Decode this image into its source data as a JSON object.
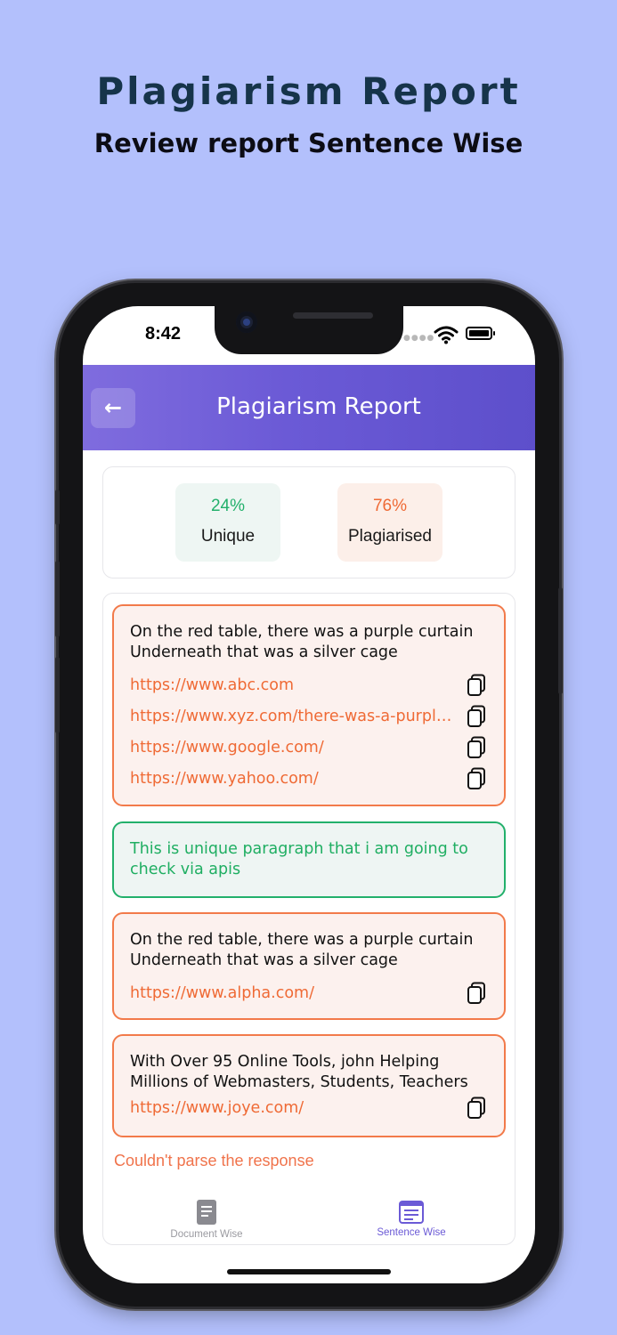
{
  "promo": {
    "title": "Plagiarism Report",
    "subtitle": "Review report Sentence Wise"
  },
  "status_bar": {
    "time": "8:42"
  },
  "header": {
    "title": "Plagiarism Report",
    "back_icon": "arrow-left-icon"
  },
  "stats": {
    "unique": {
      "percent": "24%",
      "label": "Unique",
      "color": "#22b06b"
    },
    "plagiarised": {
      "percent": "76%",
      "label": "Plagiarised",
      "color": "#ef6a35"
    }
  },
  "results": [
    {
      "type": "plagiarised",
      "text": "On the red table, there was a purple curtain Underneath that was a silver cage",
      "links": [
        "https://www.abc.com",
        "https://www.xyz.com/there-was-a-purple-curtain",
        "https://www.google.com/",
        "https://www.yahoo.com/"
      ]
    },
    {
      "type": "unique",
      "text": "This is unique paragraph that i am going to check via apis",
      "links": []
    },
    {
      "type": "plagiarised",
      "text": "On the red table, there was a purple curtain Underneath that was a silver cage",
      "links": [
        "https://www.alpha.com/"
      ]
    },
    {
      "type": "plagiarised",
      "text": "With Over 95 Online Tools, john Helping Millions of Webmasters, Students, Teachers",
      "links": [
        "https://www.joye.com/"
      ]
    }
  ],
  "error_message": "Couldn't parse the response",
  "tabs": [
    {
      "label": "Document Wise",
      "icon": "document-icon",
      "active": false
    },
    {
      "label": "Sentence Wise",
      "icon": "sentence-list-icon",
      "active": true
    }
  ],
  "colors": {
    "background": "#b3c0fc",
    "accent": "#6b5ad6",
    "plagiarised": "#ef6a35",
    "unique": "#22b06b"
  }
}
